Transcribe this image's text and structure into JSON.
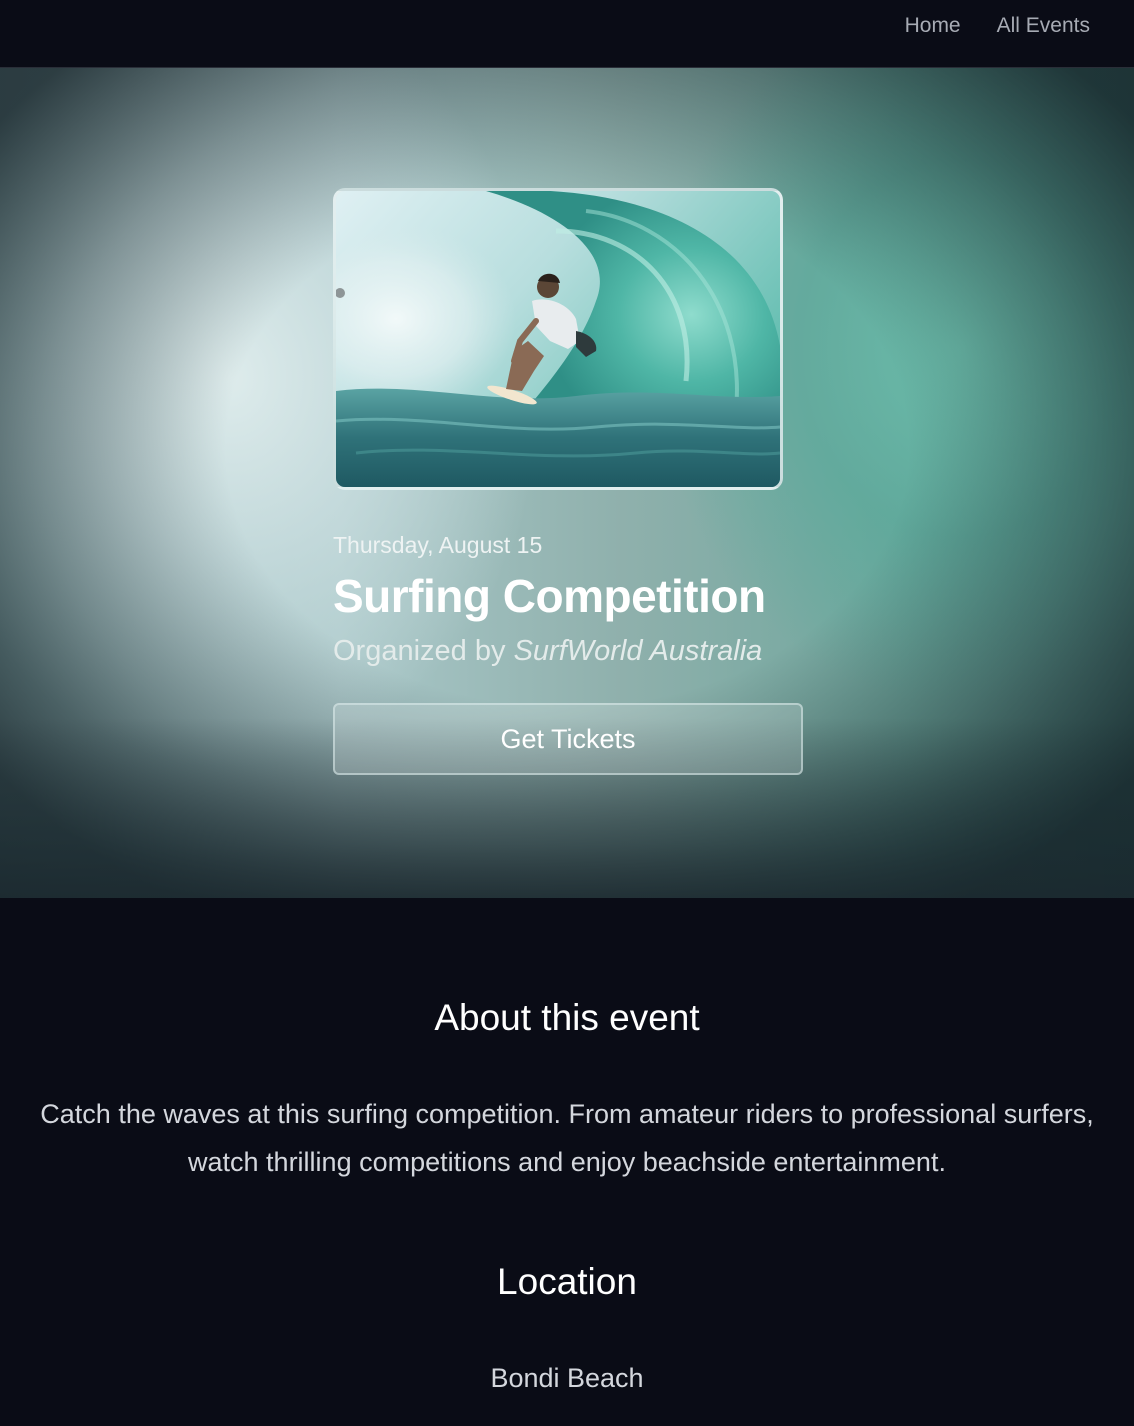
{
  "nav": {
    "home_label": "Home",
    "all_events_label": "All Events"
  },
  "event": {
    "date": "Thursday, August 15",
    "title": "Surfing Competition",
    "organizer_prefix": "Organized by",
    "organizer_name": "SurfWorld Australia",
    "tickets_label": "Get Tickets",
    "image_icon": "surfer-photo"
  },
  "about": {
    "heading": "About this event",
    "description": "Catch the waves at this surfing competition. From amateur riders to professional surfers, watch thrilling competitions and enjoy beachside entertainment."
  },
  "location": {
    "heading": "Location",
    "name": "Bondi Beach"
  },
  "colors": {
    "page_background": "#0a0c16",
    "nav_text": "#a7abb4",
    "body_text": "#d4d7dd",
    "hero_teal": "#6fa79d"
  }
}
